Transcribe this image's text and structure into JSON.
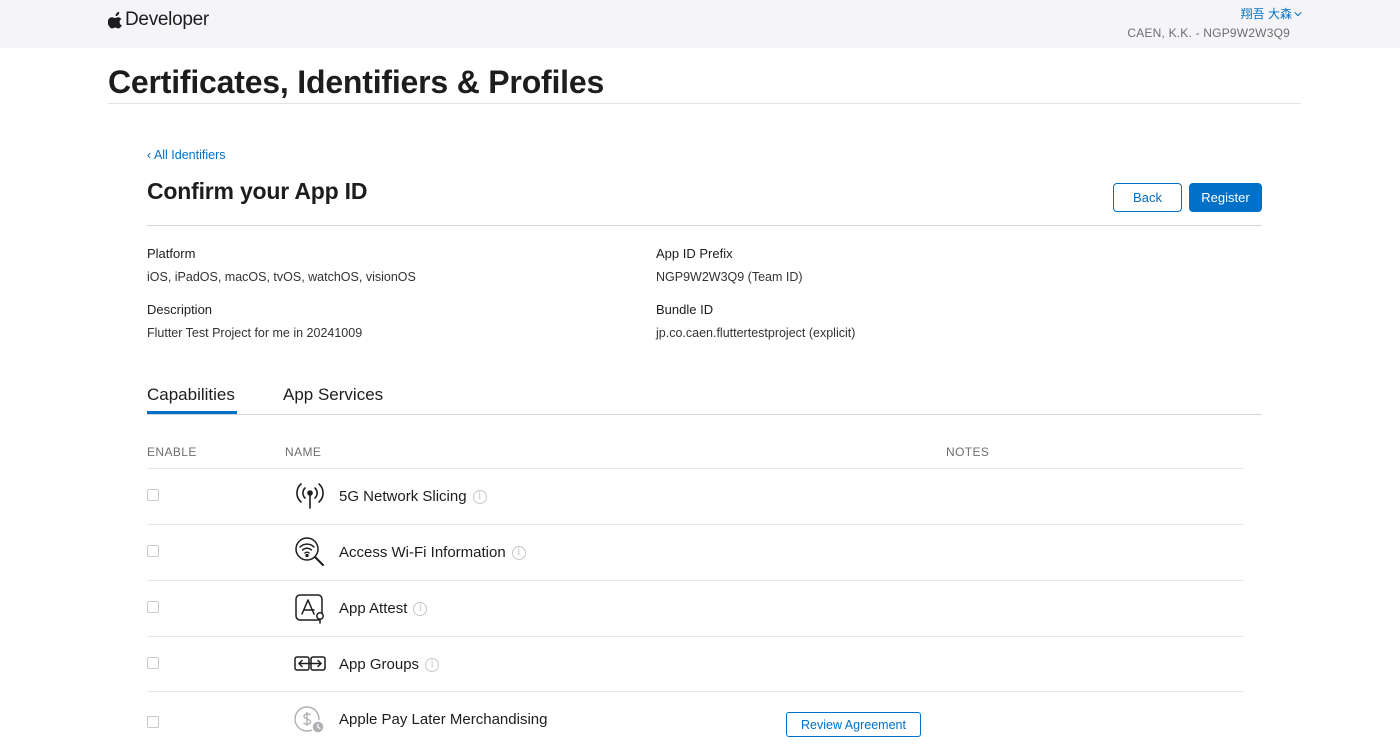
{
  "header": {
    "brand": "Developer",
    "user_name": "翔吾 大森",
    "team_label": "CAEN, K.K. - NGP9W2W3Q9"
  },
  "page_title": "Certificates, Identifiers & Profiles",
  "back_link": "‹ All Identifiers",
  "section_title": "Confirm your App ID",
  "buttons": {
    "back": "Back",
    "register": "Register"
  },
  "details": {
    "platform_label": "Platform",
    "platform_value": "iOS, iPadOS, macOS, tvOS, watchOS, visionOS",
    "description_label": "Description",
    "description_value": "Flutter Test Project for me in 20241009",
    "prefix_label": "App ID Prefix",
    "prefix_value": "NGP9W2W3Q9 (Team ID)",
    "bundle_label": "Bundle ID",
    "bundle_value": "jp.co.caen.fluttertestproject (explicit)"
  },
  "tabs": [
    {
      "label": "Capabilities",
      "active": true
    },
    {
      "label": "App Services",
      "active": false
    }
  ],
  "columns": {
    "enable": "ENABLE",
    "name": "NAME",
    "notes": "NOTES"
  },
  "capabilities": [
    {
      "name": "5G Network Slicing",
      "icon": "antenna-icon",
      "checked": false
    },
    {
      "name": "Access Wi-Fi Information",
      "icon": "wifi-search-icon",
      "checked": false
    },
    {
      "name": "App Attest",
      "icon": "app-attest-icon",
      "checked": false
    },
    {
      "name": "App Groups",
      "icon": "app-groups-icon",
      "checked": false
    },
    {
      "name": "Apple Pay Later Merchandising",
      "icon": "apple-pay-later-icon",
      "checked": false,
      "note_button": "Review Agreement"
    }
  ],
  "colors": {
    "accent": "#0070c9",
    "topbar": "#f5f5f7"
  }
}
